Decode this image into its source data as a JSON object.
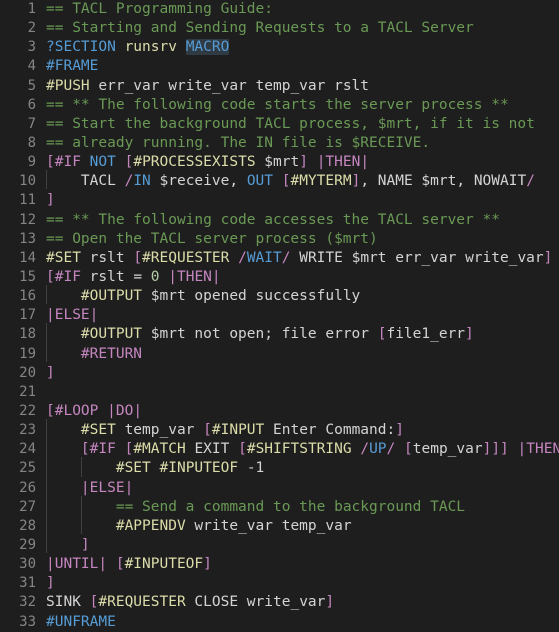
{
  "editor": {
    "theme": "dark-plus",
    "background": "#1e1e1e",
    "gutter_color": "#858585",
    "default_text_color": "#d4d4d4",
    "font_size_px": 14.5,
    "line_height_px": 19.15,
    "language": "TACL",
    "indent_guide_color": "#404040",
    "word_highlight_background": "#2f3a42",
    "colors": {
      "comment": "#6a9955",
      "builtin": "#569cd6",
      "function": "#dcdcaa",
      "control": "#c586c0",
      "punctuation": "#c586c0",
      "variable": "#d4d4d4",
      "number": "#b5cea8"
    },
    "lines": [
      {
        "number": "1",
        "indent_guides": 0,
        "tokens": [
          {
            "text": "== TACL Programming Guide:",
            "style": "t-comment"
          }
        ]
      },
      {
        "number": "2",
        "indent_guides": 0,
        "tokens": [
          {
            "text": "== Starting and Sending Requests to a TACL Server",
            "style": "t-comment"
          }
        ]
      },
      {
        "number": "3",
        "indent_guides": 0,
        "tokens": [
          {
            "text": "?SECTION",
            "style": "t-builtin"
          },
          {
            "text": " ",
            "style": "t-plain"
          },
          {
            "text": "runsrv",
            "style": "t-fn"
          },
          {
            "text": " ",
            "style": "t-plain"
          },
          {
            "text": "MACRO",
            "style": "t-builtin hl-word"
          }
        ]
      },
      {
        "number": "4",
        "indent_guides": 0,
        "tokens": [
          {
            "text": "#FRAME",
            "style": "t-builtin"
          }
        ]
      },
      {
        "number": "5",
        "indent_guides": 0,
        "tokens": [
          {
            "text": "#PUSH",
            "style": "t-fn"
          },
          {
            "text": " err_var write_var temp_var rslt",
            "style": "t-plain"
          }
        ]
      },
      {
        "number": "6",
        "indent_guides": 0,
        "tokens": [
          {
            "text": "== ** The following code starts the server process **",
            "style": "t-comment"
          }
        ]
      },
      {
        "number": "7",
        "indent_guides": 0,
        "tokens": [
          {
            "text": "== Start the background TACL process, $mrt, if it is not",
            "style": "t-comment"
          }
        ]
      },
      {
        "number": "8",
        "indent_guides": 0,
        "tokens": [
          {
            "text": "== already running. The IN file is $RECEIVE.",
            "style": "t-comment"
          }
        ]
      },
      {
        "number": "9",
        "indent_guides": 0,
        "tokens": [
          {
            "text": "[",
            "style": "t-punct"
          },
          {
            "text": "#IF",
            "style": "t-ctrl"
          },
          {
            "text": " ",
            "style": "t-plain"
          },
          {
            "text": "NOT",
            "style": "t-builtin"
          },
          {
            "text": " ",
            "style": "t-plain"
          },
          {
            "text": "[",
            "style": "t-punct"
          },
          {
            "text": "#PROCESSEXISTS",
            "style": "t-fn"
          },
          {
            "text": " $mrt",
            "style": "t-plain"
          },
          {
            "text": "]",
            "style": "t-punct"
          },
          {
            "text": " ",
            "style": "t-plain"
          },
          {
            "text": "|THEN|",
            "style": "t-ctrl"
          }
        ]
      },
      {
        "number": "10",
        "indent_guides": 1,
        "tokens": [
          {
            "text": "    TACL ",
            "style": "t-plain"
          },
          {
            "text": "/",
            "style": "t-punct"
          },
          {
            "text": "IN",
            "style": "t-builtin"
          },
          {
            "text": " $receive, ",
            "style": "t-plain"
          },
          {
            "text": "OUT",
            "style": "t-builtin"
          },
          {
            "text": " ",
            "style": "t-plain"
          },
          {
            "text": "[",
            "style": "t-punct"
          },
          {
            "text": "#MYTERM",
            "style": "t-fn"
          },
          {
            "text": "]",
            "style": "t-punct"
          },
          {
            "text": ", NAME $mrt, NOWAIT",
            "style": "t-plain"
          },
          {
            "text": "/",
            "style": "t-punct"
          }
        ]
      },
      {
        "number": "11",
        "indent_guides": 0,
        "tokens": [
          {
            "text": "]",
            "style": "t-punct"
          }
        ]
      },
      {
        "number": "12",
        "indent_guides": 0,
        "tokens": [
          {
            "text": "== ** The following code accesses the TACL server **",
            "style": "t-comment"
          }
        ]
      },
      {
        "number": "13",
        "indent_guides": 0,
        "tokens": [
          {
            "text": "== Open the TACL server process ($mrt)",
            "style": "t-comment"
          }
        ]
      },
      {
        "number": "14",
        "indent_guides": 0,
        "tokens": [
          {
            "text": "#SET",
            "style": "t-fn"
          },
          {
            "text": " rslt ",
            "style": "t-plain"
          },
          {
            "text": "[",
            "style": "t-punct"
          },
          {
            "text": "#REQUESTER",
            "style": "t-fn"
          },
          {
            "text": " ",
            "style": "t-plain"
          },
          {
            "text": "/",
            "style": "t-punct"
          },
          {
            "text": "WAIT",
            "style": "t-builtin"
          },
          {
            "text": "/",
            "style": "t-punct"
          },
          {
            "text": " WRITE $mrt err_var write_var",
            "style": "t-plain"
          },
          {
            "text": "]",
            "style": "t-punct"
          }
        ]
      },
      {
        "number": "15",
        "indent_guides": 0,
        "tokens": [
          {
            "text": "[",
            "style": "t-punct"
          },
          {
            "text": "#IF",
            "style": "t-ctrl"
          },
          {
            "text": " rslt = ",
            "style": "t-plain"
          },
          {
            "text": "0",
            "style": "t-num"
          },
          {
            "text": " ",
            "style": "t-plain"
          },
          {
            "text": "|THEN|",
            "style": "t-ctrl"
          }
        ]
      },
      {
        "number": "16",
        "indent_guides": 1,
        "tokens": [
          {
            "text": "    ",
            "style": "t-plain"
          },
          {
            "text": "#OUTPUT",
            "style": "t-fn"
          },
          {
            "text": " $mrt opened successfully",
            "style": "t-plain"
          }
        ]
      },
      {
        "number": "17",
        "indent_guides": 0,
        "tokens": [
          {
            "text": "|ELSE|",
            "style": "t-ctrl"
          }
        ]
      },
      {
        "number": "18",
        "indent_guides": 1,
        "tokens": [
          {
            "text": "    ",
            "style": "t-plain"
          },
          {
            "text": "#OUTPUT",
            "style": "t-fn"
          },
          {
            "text": " $mrt not open; file error ",
            "style": "t-plain"
          },
          {
            "text": "[",
            "style": "t-punct"
          },
          {
            "text": "file1_err",
            "style": "t-plain"
          },
          {
            "text": "]",
            "style": "t-punct"
          }
        ]
      },
      {
        "number": "19",
        "indent_guides": 1,
        "tokens": [
          {
            "text": "    ",
            "style": "t-plain"
          },
          {
            "text": "#RETURN",
            "style": "t-ctrl"
          }
        ]
      },
      {
        "number": "20",
        "indent_guides": 0,
        "tokens": [
          {
            "text": "]",
            "style": "t-punct"
          }
        ]
      },
      {
        "number": "21",
        "indent_guides": 0,
        "tokens": []
      },
      {
        "number": "22",
        "indent_guides": 0,
        "tokens": [
          {
            "text": "[",
            "style": "t-punct"
          },
          {
            "text": "#LOOP",
            "style": "t-ctrl"
          },
          {
            "text": " ",
            "style": "t-plain"
          },
          {
            "text": "|DO|",
            "style": "t-ctrl"
          }
        ]
      },
      {
        "number": "23",
        "indent_guides": 1,
        "tokens": [
          {
            "text": "    ",
            "style": "t-plain"
          },
          {
            "text": "#SET",
            "style": "t-fn"
          },
          {
            "text": " temp_var ",
            "style": "t-plain"
          },
          {
            "text": "[",
            "style": "t-punct"
          },
          {
            "text": "#INPUT",
            "style": "t-fn"
          },
          {
            "text": " Enter Command:",
            "style": "t-plain"
          },
          {
            "text": "]",
            "style": "t-punct"
          }
        ]
      },
      {
        "number": "24",
        "indent_guides": 1,
        "tokens": [
          {
            "text": "    ",
            "style": "t-plain"
          },
          {
            "text": "[",
            "style": "t-punct"
          },
          {
            "text": "#IF",
            "style": "t-ctrl"
          },
          {
            "text": " ",
            "style": "t-plain"
          },
          {
            "text": "[",
            "style": "t-punct"
          },
          {
            "text": "#MATCH",
            "style": "t-fn"
          },
          {
            "text": " EXIT ",
            "style": "t-plain"
          },
          {
            "text": "[",
            "style": "t-punct"
          },
          {
            "text": "#SHIFTSTRING",
            "style": "t-fn"
          },
          {
            "text": " ",
            "style": "t-plain"
          },
          {
            "text": "/",
            "style": "t-punct"
          },
          {
            "text": "UP",
            "style": "t-builtin"
          },
          {
            "text": "/",
            "style": "t-punct"
          },
          {
            "text": " ",
            "style": "t-plain"
          },
          {
            "text": "[",
            "style": "t-punct"
          },
          {
            "text": "temp_var",
            "style": "t-plain"
          },
          {
            "text": "]]]",
            "style": "t-punct"
          },
          {
            "text": " ",
            "style": "t-plain"
          },
          {
            "text": "|THEN|",
            "style": "t-ctrl"
          }
        ]
      },
      {
        "number": "25",
        "indent_guides": 2,
        "tokens": [
          {
            "text": "        ",
            "style": "t-plain"
          },
          {
            "text": "#SET",
            "style": "t-fn"
          },
          {
            "text": " ",
            "style": "t-plain"
          },
          {
            "text": "#INPUTEOF",
            "style": "t-fn"
          },
          {
            "text": " ",
            "style": "t-plain"
          },
          {
            "text": "-1",
            "style": "t-plain"
          }
        ]
      },
      {
        "number": "26",
        "indent_guides": 1,
        "tokens": [
          {
            "text": "    ",
            "style": "t-plain"
          },
          {
            "text": "|ELSE|",
            "style": "t-ctrl"
          }
        ]
      },
      {
        "number": "27",
        "indent_guides": 2,
        "tokens": [
          {
            "text": "        ",
            "style": "t-plain"
          },
          {
            "text": "== Send a command to the background TACL",
            "style": "t-comment"
          }
        ]
      },
      {
        "number": "28",
        "indent_guides": 2,
        "tokens": [
          {
            "text": "        ",
            "style": "t-plain"
          },
          {
            "text": "#APPENDV",
            "style": "t-fn"
          },
          {
            "text": " write_var temp_var",
            "style": "t-plain"
          }
        ]
      },
      {
        "number": "29",
        "indent_guides": 1,
        "tokens": [
          {
            "text": "    ",
            "style": "t-plain"
          },
          {
            "text": "]",
            "style": "t-punct"
          }
        ]
      },
      {
        "number": "30",
        "indent_guides": 0,
        "tokens": [
          {
            "text": "|UNTIL|",
            "style": "t-ctrl"
          },
          {
            "text": " ",
            "style": "t-plain"
          },
          {
            "text": "[",
            "style": "t-punct"
          },
          {
            "text": "#INPUTEOF",
            "style": "t-fn"
          },
          {
            "text": "]",
            "style": "t-punct"
          }
        ]
      },
      {
        "number": "31",
        "indent_guides": 0,
        "tokens": [
          {
            "text": "]",
            "style": "t-punct"
          }
        ]
      },
      {
        "number": "32",
        "indent_guides": 0,
        "tokens": [
          {
            "text": "SINK ",
            "style": "t-plain"
          },
          {
            "text": "[",
            "style": "t-punct"
          },
          {
            "text": "#REQUESTER",
            "style": "t-fn"
          },
          {
            "text": " CLOSE write_var",
            "style": "t-plain"
          },
          {
            "text": "]",
            "style": "t-punct"
          }
        ]
      },
      {
        "number": "33",
        "indent_guides": 0,
        "tokens": [
          {
            "text": "#UNFRAME",
            "style": "t-builtin"
          }
        ]
      }
    ]
  }
}
